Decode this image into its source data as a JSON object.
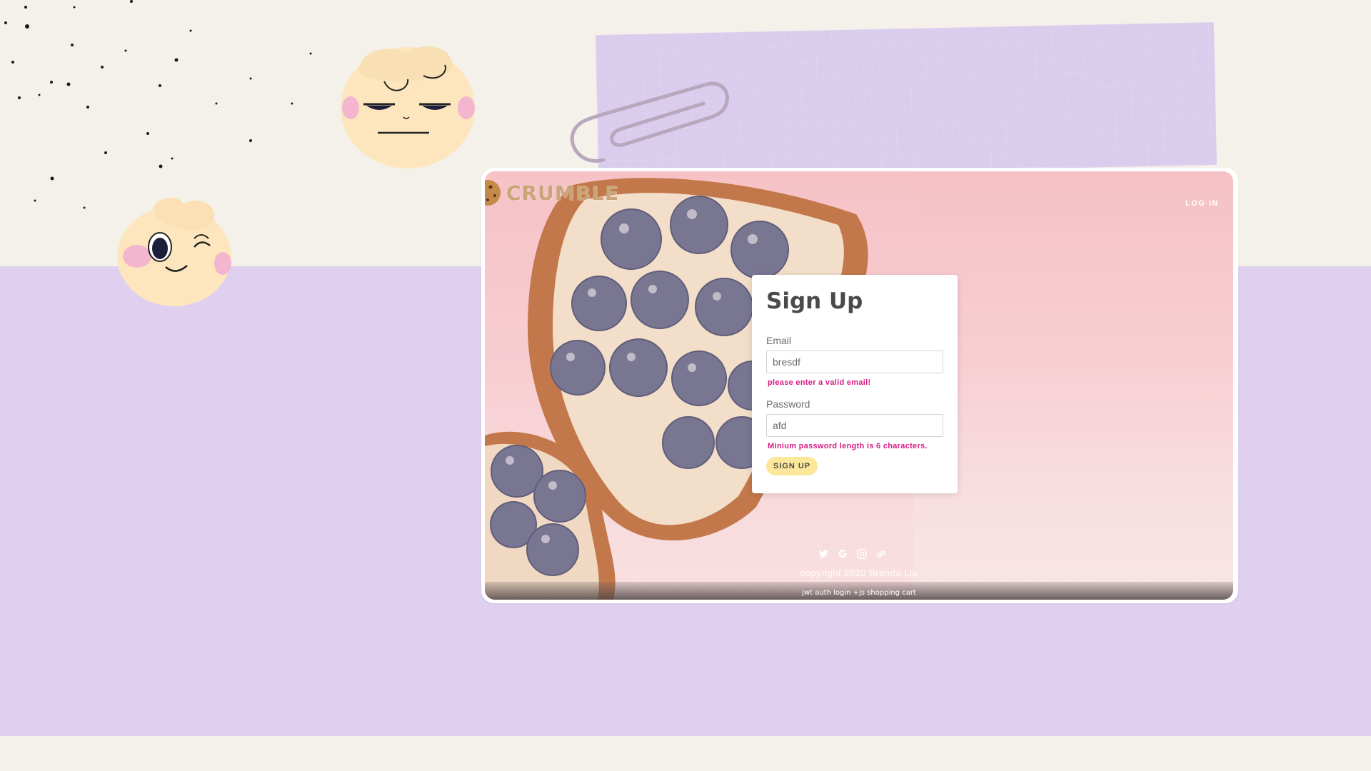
{
  "app": {
    "logo_text": "CRUMBLE",
    "nav_login": "LOG IN"
  },
  "form": {
    "title": "Sign Up",
    "email": {
      "label": "Email",
      "value": "bresdf",
      "error": "please enter a valid email!"
    },
    "password": {
      "label": "Password",
      "value": "afd",
      "error": "Minium password length is 6 characters."
    },
    "submit_label": "SIGN UP"
  },
  "footer": {
    "social_icons": [
      "twitter-icon",
      "google-icon",
      "instagram-icon",
      "link-icon"
    ],
    "copyright": "copyright 2020 Brenda Liu",
    "caption": "jwt auth login +js shopping cart"
  },
  "colors": {
    "background": "#f4f1ea",
    "lavender": "#ded0ee",
    "error": "#d61c85",
    "button": "#fde79a",
    "logo": "#c9a57a"
  }
}
